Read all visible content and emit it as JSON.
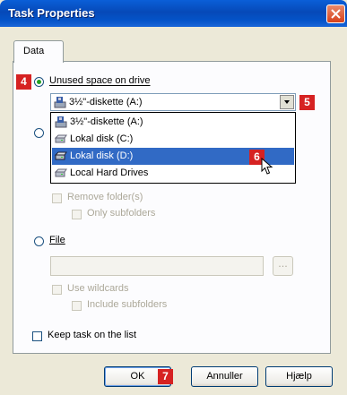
{
  "window": {
    "title": "Task Properties"
  },
  "tabs": [
    {
      "label": "Data"
    }
  ],
  "markers": {
    "m4": "4",
    "m5": "5",
    "m6": "6",
    "m7": "7"
  },
  "options": {
    "unused_space": {
      "label": "Unused space on drive",
      "selected": true
    },
    "file": {
      "label": "File",
      "selected": false
    },
    "remove_folders": {
      "label": "Remove folder(s)",
      "checked": false
    },
    "only_subfolders": {
      "label": "Only subfolders",
      "checked": false
    },
    "use_wildcards": {
      "label": "Use wildcards",
      "checked": false
    },
    "include_subfolders": {
      "label": "Include subfolders",
      "checked": false
    },
    "keep_task": {
      "label": "Keep task on the list",
      "checked": false
    }
  },
  "drive_combo": {
    "selected": "3½\"-diskette (A:)",
    "items": [
      {
        "label": "3½\"-diskette (A:)",
        "icon": "floppy-drive-icon"
      },
      {
        "label": "Lokal disk (C:)",
        "icon": "hard-drive-icon"
      },
      {
        "label": "Lokal disk (D:)",
        "icon": "hard-drive-icon",
        "highlighted": true
      },
      {
        "label": "Local Hard Drives",
        "icon": "hard-drive-icon"
      }
    ]
  },
  "file_field": {
    "value": "",
    "browse_label": "..."
  },
  "buttons": {
    "ok": "OK",
    "cancel": "Annuller",
    "help": "Hjælp"
  },
  "colors": {
    "titlebar": "#0a5fd8",
    "selection": "#316ac5",
    "marker": "#d62222"
  }
}
